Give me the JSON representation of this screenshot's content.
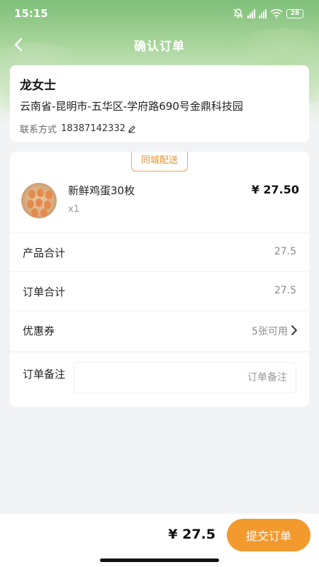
{
  "status_bar": {
    "time": "15:15",
    "battery": "28",
    "icons": [
      "mute-bell-icon",
      "hd-signal-icon",
      "hd-signal-icon",
      "wifi-icon",
      "battery-icon"
    ]
  },
  "header": {
    "title": "确认订单",
    "back_icon": "chevron-left-icon"
  },
  "address": {
    "name": "龙女士",
    "full_address": "云南省-昆明市-五华区-学府路690号金鼎科技园",
    "contact_label": "联系方式",
    "phone": "18387142332",
    "edit_icon": "pencil-icon"
  },
  "order": {
    "delivery_tag": "同城配送",
    "product": {
      "name": "新鲜鸡蛋30枚",
      "quantity": "x1",
      "price": "¥ 27.50"
    },
    "rows": {
      "product_total_label": "产品合计",
      "product_total_value": "27.5",
      "order_total_label": "订单合计",
      "order_total_value": "27.5",
      "coupon_label": "优惠券",
      "coupon_value": "5张可用",
      "remark_label": "订单备注",
      "remark_placeholder": "订单备注"
    }
  },
  "footer": {
    "total": "¥ 27.5",
    "submit_label": "提交订单"
  },
  "colors": {
    "accent": "#f29a2e",
    "tag_border": "#f0a44a",
    "background": "#f2f3f5"
  }
}
